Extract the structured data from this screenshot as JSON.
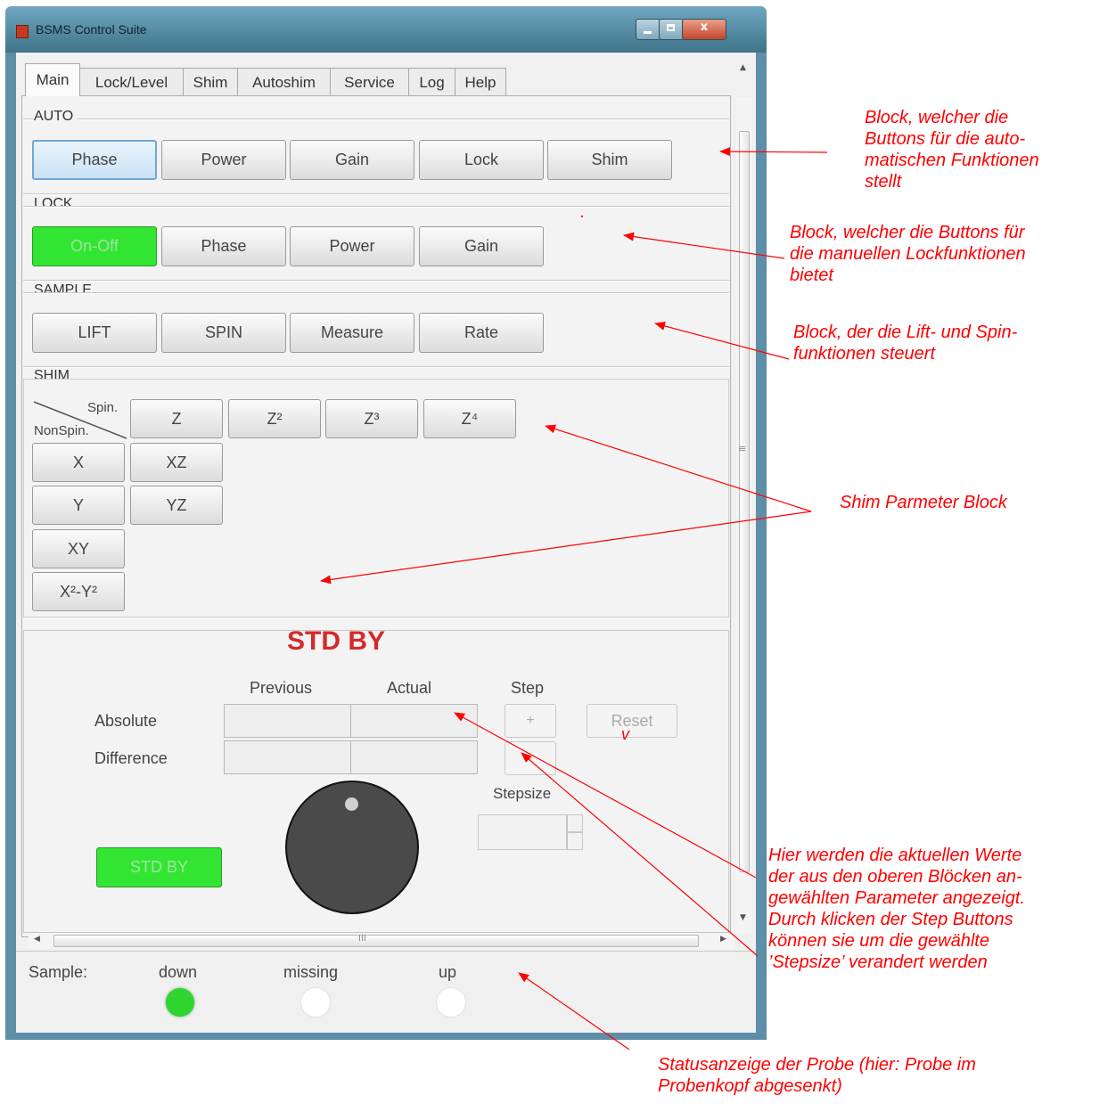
{
  "window": {
    "title": "BSMS Control Suite",
    "minimize_label": "",
    "maximize_label": "",
    "close_label": "x"
  },
  "tabs": [
    "Main",
    "Lock/Level",
    "Shim",
    "Autoshim",
    "Service",
    "Log",
    "Help"
  ],
  "active_tab": "Main",
  "auto": {
    "label": "AUTO",
    "buttons": [
      "Phase",
      "Power",
      "Gain",
      "Lock",
      "Shim"
    ],
    "selected": "Phase"
  },
  "lock": {
    "label": "LOCK",
    "buttons": [
      "On-Off",
      "Phase",
      "Power",
      "Gain"
    ],
    "active": "On-Off"
  },
  "sample": {
    "label": "SAMPLE",
    "buttons": [
      "LIFT",
      "SPIN",
      "Measure",
      "Rate"
    ]
  },
  "shim": {
    "label": "SHIM",
    "header_spin": "Spin.",
    "header_nonspin": "NonSpin.",
    "spin_buttons": [
      "Z",
      "Z²",
      "Z³",
      "Z⁴"
    ],
    "nonspin_buttons": [
      "X",
      "XZ",
      "Y",
      "YZ",
      "XY",
      "X²-Y²"
    ]
  },
  "values": {
    "status_title": "STD BY",
    "col_previous": "Previous",
    "col_actual": "Actual",
    "col_step": "Step",
    "row_absolute": "Absolute",
    "row_difference": "Difference",
    "step_plus": "+",
    "step_minus": "-",
    "reset_label": "Reset",
    "stepsize_label": "Stepsize",
    "stdby_button": "STD BY",
    "stray_mark": "v"
  },
  "statusbar": {
    "label": "Sample:",
    "states": [
      {
        "label": "down",
        "color": "#2fd42f",
        "active": true
      },
      {
        "label": "missing",
        "color": "#ffffff",
        "active": false
      },
      {
        "label": "up",
        "color": "#ffffff",
        "active": false
      }
    ],
    "scroll_grip": "III",
    "vscroll_grip": "≡"
  },
  "annotations": {
    "auto_block": [
      "Block, welcher die",
      "Buttons für die auto-",
      "matischen Funktionen",
      "stellt"
    ],
    "lock_block": [
      "Block, welcher die Buttons für",
      "die manuellen Lockfunktionen",
      "bietet"
    ],
    "sample_block": [
      "Block, der die Lift- und Spin-",
      "funktionen steuert"
    ],
    "shim_block": [
      "Shim Parmeter Block"
    ],
    "values_block": [
      "Hier werden die aktuellen Werte",
      "der aus den oberen Blöcken an-",
      "gewählten Parameter angezeigt.",
      "Durch klicken der Step Buttons",
      "können sie um die gewählte",
      "’Stepsize’ verandert werden"
    ],
    "status_block": [
      "Statusanzeige der Probe (hier: Probe im",
      "Probenkopf abgesenkt)"
    ],
    "dot": "."
  },
  "colors": {
    "annotation": "#ff0000",
    "led_on": "#2fd42f",
    "lock_active": "#33e533",
    "status_title": "#d42a2a"
  }
}
